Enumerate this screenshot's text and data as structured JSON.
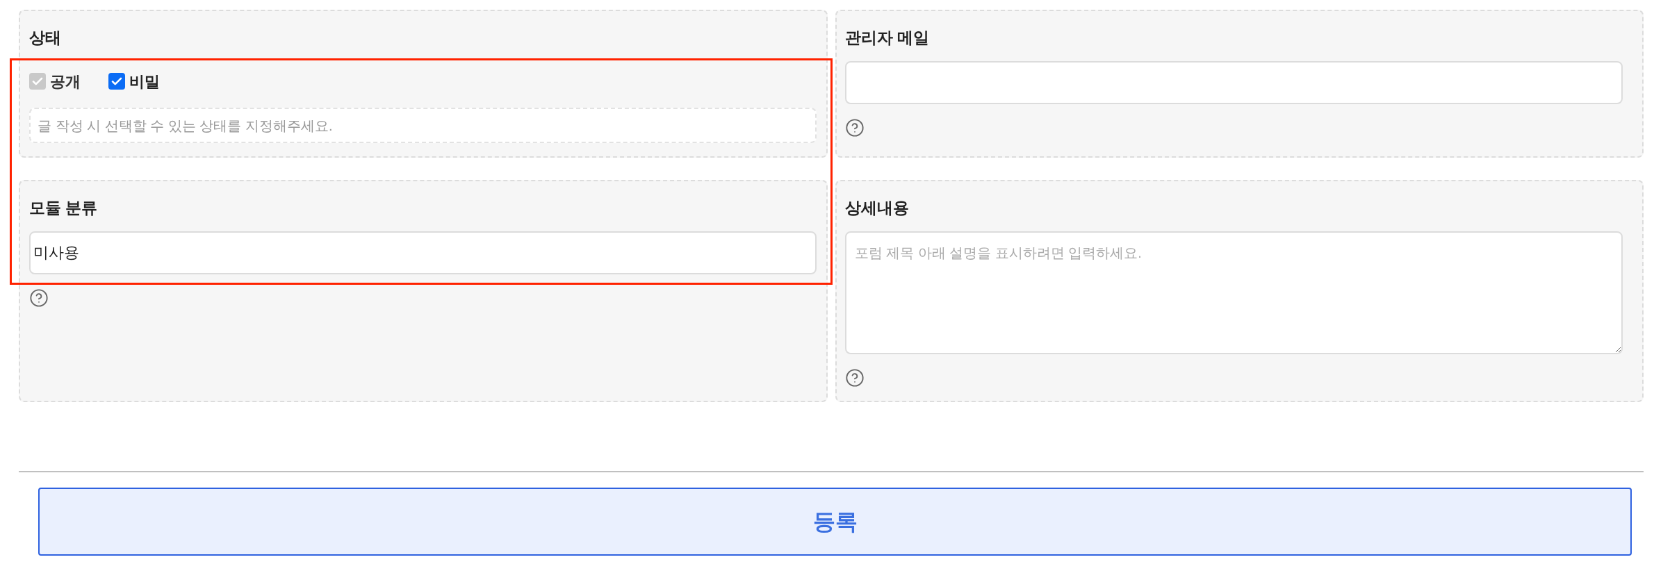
{
  "panels": [
    {
      "kind": "checkboxes",
      "title": "상태",
      "options": [
        {
          "label": "공개",
          "checked": true,
          "disabled": true
        },
        {
          "label": "비밀",
          "checked": true,
          "disabled": false
        }
      ],
      "hint": "글 작성 시 선택할 수 있는 상태를 지정해주세요."
    },
    {
      "kind": "input",
      "title": "관리자 메일",
      "help": true
    },
    {
      "kind": "input",
      "title": "모듈 분류",
      "value": "미사용",
      "help": true
    },
    {
      "kind": "textarea",
      "title": "상세내용",
      "placeholder": "포럼 제목 아래 설명을 표시하려면 입력하세요.",
      "help": true
    }
  ],
  "highlight": true,
  "submit_button": "등록"
}
